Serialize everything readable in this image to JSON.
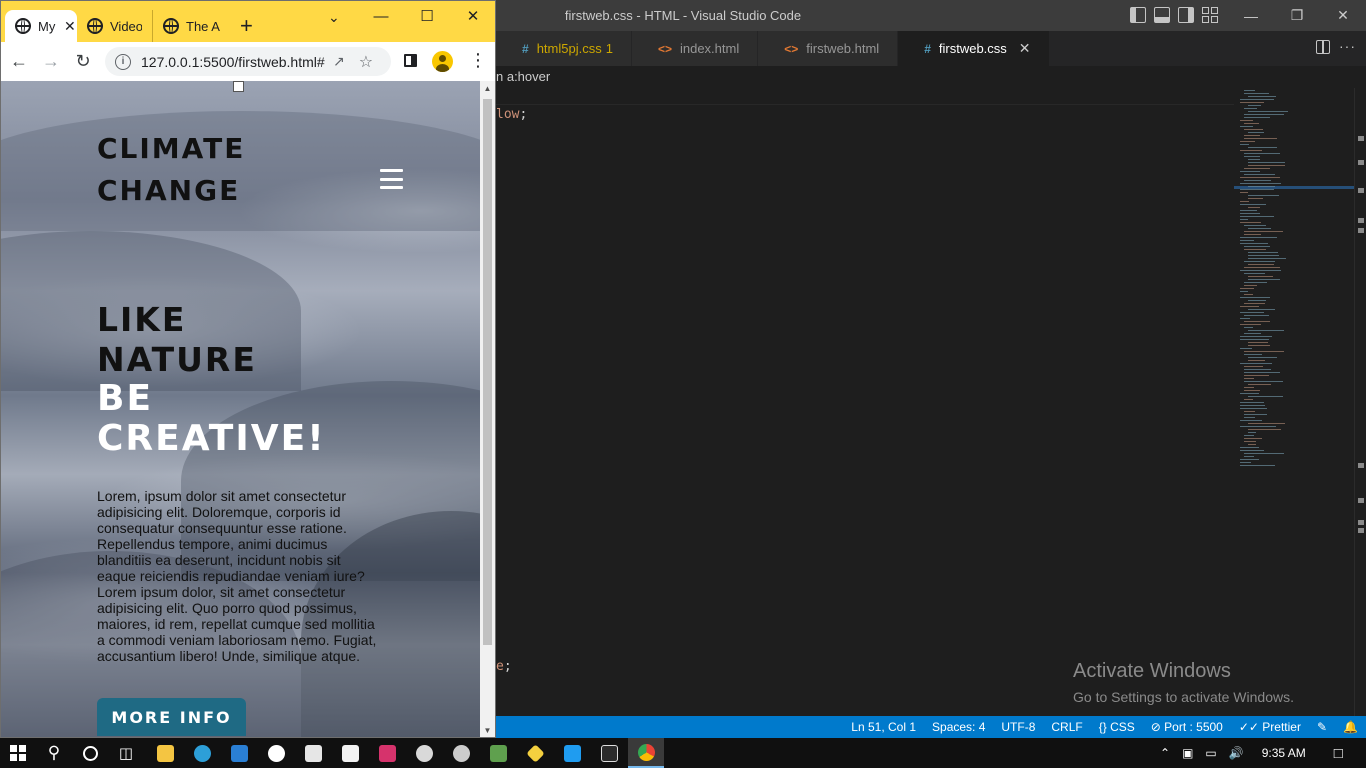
{
  "vscode": {
    "title": "firstweb.css - HTML - Visual Studio Code",
    "tabs": [
      {
        "label": "html5pj.css",
        "icon": "#",
        "badge": "1"
      },
      {
        "label": "index.html",
        "icon": "<>"
      },
      {
        "label": "firstweb.html",
        "icon": "<>"
      },
      {
        "label": "firstweb.css",
        "icon": "#",
        "close": "✕"
      }
    ],
    "breadcrumb": "n a:hover",
    "code_fragments": {
      "line1_value": "low",
      "line1_punct": ";",
      "line2_value": "e",
      "line2_punct": ";"
    },
    "activate_windows": {
      "title": "Activate Windows",
      "subtitle": "Go to Settings to activate Windows."
    },
    "statusbar": {
      "position": "Ln 51, Col 1",
      "spaces": "Spaces: 4",
      "encoding": "UTF-8",
      "eol": "CRLF",
      "language": "{} CSS",
      "port": "⊘ Port : 5500",
      "prettier": "✓✓ Prettier"
    },
    "accent_color": "#007acc"
  },
  "chrome": {
    "tabs": [
      {
        "title": "My",
        "close": "✕"
      },
      {
        "title": "Video"
      },
      {
        "title": "The A"
      }
    ],
    "new_tab": "+",
    "url": "127.0.0.1:5500/firstweb.html#",
    "info_icon": "i",
    "tab_strip_color": "#ffd945"
  },
  "site": {
    "logo_line1": "CLIMATE",
    "logo_line2": "CHANGE",
    "hero_dark_1": "LIKE",
    "hero_dark_2": "NATURE",
    "hero_light_1": "BE",
    "hero_light_2": "CREATIVE!",
    "body_text": "Lorem, ipsum dolor sit amet consectetur adipisicing elit. Doloremque, corporis id consequatur consequuntur esse ratione. Repellendus tempore, animi ducimus blanditiis ea deserunt, incidunt nobis sit eaque reiciendis repudiandae veniam iure? Lorem ipsum dolor, sit amet consectetur adipisicing elit. Quo porro quod possimus, maiores, id rem, repellat cumque sed mollitia a commodi veniam laboriosam nemo. Fugiat, accusantium libero! Unde, similique atque.",
    "button_label": "MORE INFO",
    "button_color": "#1f6a84"
  },
  "taskbar": {
    "clock": "9:35 AM"
  }
}
